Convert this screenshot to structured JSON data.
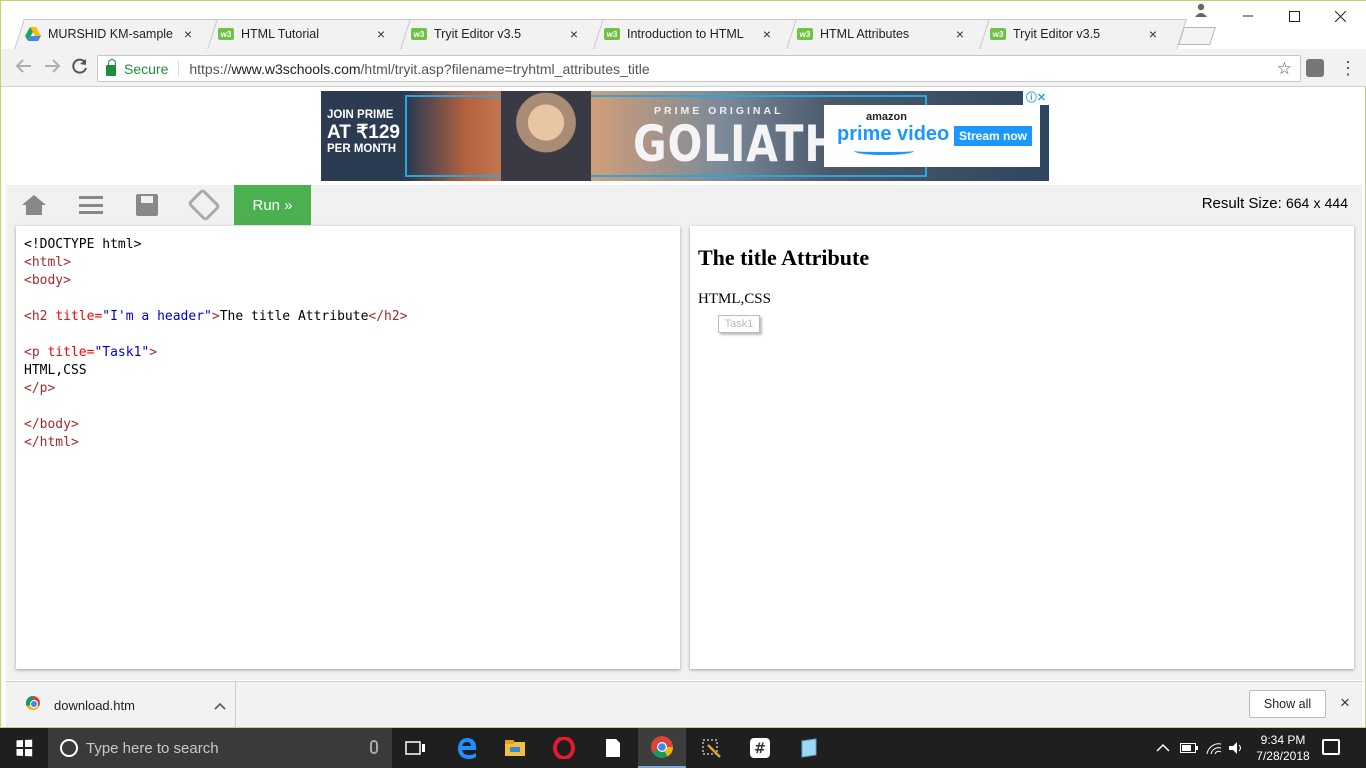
{
  "browser": {
    "tabs": [
      {
        "title": "MURSHID KM-sample pr",
        "favicon": "google-drive-icon"
      },
      {
        "title": "HTML Tutorial",
        "favicon": "w3schools-icon"
      },
      {
        "title": "Tryit Editor v3.5",
        "favicon": "w3schools-icon"
      },
      {
        "title": "Introduction to HTML",
        "favicon": "w3schools-icon"
      },
      {
        "title": "HTML Attributes",
        "favicon": "w3schools-icon"
      },
      {
        "title": "Tryit Editor v3.5",
        "favicon": "w3schools-icon",
        "active": true
      }
    ],
    "tab_close": "×",
    "favicon_text": "w3",
    "secure_label": "Secure",
    "url_scheme": "https://",
    "url_host": "www.w3schools.com",
    "url_path": "/html/tryit.asp?filename=tryhtml_attributes_title",
    "bookmark_star": "☆"
  },
  "ad": {
    "join_line1": "JOIN PRIME",
    "join_line2": "AT ₹129",
    "join_line3": "PER MONTH",
    "prime_original": "PRIME ORIGINAL",
    "title": "GOLIATH",
    "amazon": "amazon",
    "prime_video": "prime video",
    "cta": "Stream now"
  },
  "tryit": {
    "run_label": "Run »",
    "result_size_label": "Result Size:",
    "result_width": "664",
    "result_x": "x",
    "result_height": "444",
    "icons": [
      "home-icon",
      "menu-icon",
      "save-icon",
      "rotate-icon"
    ]
  },
  "code": {
    "doctype": "<!DOCTYPE html>",
    "html_open": "<html>",
    "body_open": "<body>",
    "h2_open_tag": "<h2",
    "h2_attr": "title=",
    "h2_value": "\"I'm a header\"",
    "h2_close_bracket": ">",
    "h2_text": "The title Attribute",
    "h2_close": "</h2>",
    "p_open_tag": "<p",
    "p_attr": "title=",
    "p_value": "\"Task1\"",
    "p_close_bracket": ">",
    "p_text": "HTML,CSS",
    "p_close": "</p>",
    "body_close": "</body>",
    "html_close": "</html>"
  },
  "result": {
    "heading": "The title Attribute",
    "paragraph": "HTML,CSS",
    "tooltip": "Task1"
  },
  "downloads": {
    "file_name": "download.htm",
    "show_all": "Show all",
    "close": "×"
  },
  "taskbar": {
    "search_placeholder": "Type here to search",
    "time": "9:34 PM",
    "date": "7/28/2018"
  },
  "colors": {
    "run_button": "#4caf50",
    "code_tag": "#a52a2a",
    "code_attr": "#ff0000",
    "code_value": "#0000cd",
    "secure": "#1e8e3e"
  }
}
